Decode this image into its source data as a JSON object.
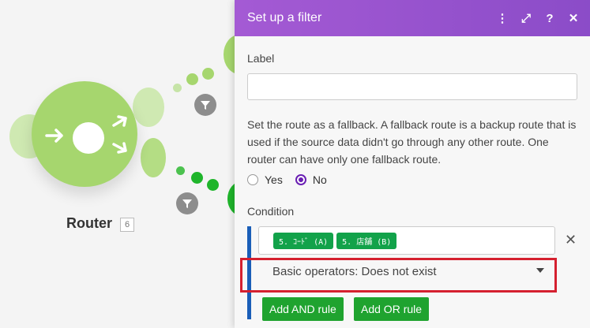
{
  "canvas": {
    "router_label": "Router",
    "router_count": "6"
  },
  "panel": {
    "title": "Set up a filter",
    "header_icons": [
      "more-vertical-icon",
      "expand-icon",
      "help-icon",
      "close-icon"
    ],
    "header_glyphs": [
      "⋮",
      "⤢",
      "?",
      "✕"
    ],
    "label_field": {
      "label": "Label",
      "value": ""
    },
    "fallback_description": "Set the route as a fallback. A fallback route is a backup route that is used if the source data didn't go through any other route. One router can have only one fallback route.",
    "fallback_options": [
      {
        "label": "Yes",
        "checked": false
      },
      {
        "label": "No",
        "checked": true
      }
    ],
    "condition": {
      "label": "Condition",
      "pills": [
        "5. ｺｰﾄﾞ (A)",
        "5. 店舗 (B)"
      ],
      "operator": "Basic operators: Does not exist",
      "remove_glyph": "✕"
    },
    "buttons": {
      "add_and": "Add AND rule",
      "add_or": "Add OR rule"
    }
  },
  "colors": {
    "header_purple": "#9b52d0",
    "accent_purple": "#6a1fb3",
    "router_green": "#a6d66e",
    "pill_green": "#12a24a",
    "button_green": "#1fa32f",
    "condition_bar_blue": "#1a5eb8",
    "highlight_red": "#d5202f"
  }
}
